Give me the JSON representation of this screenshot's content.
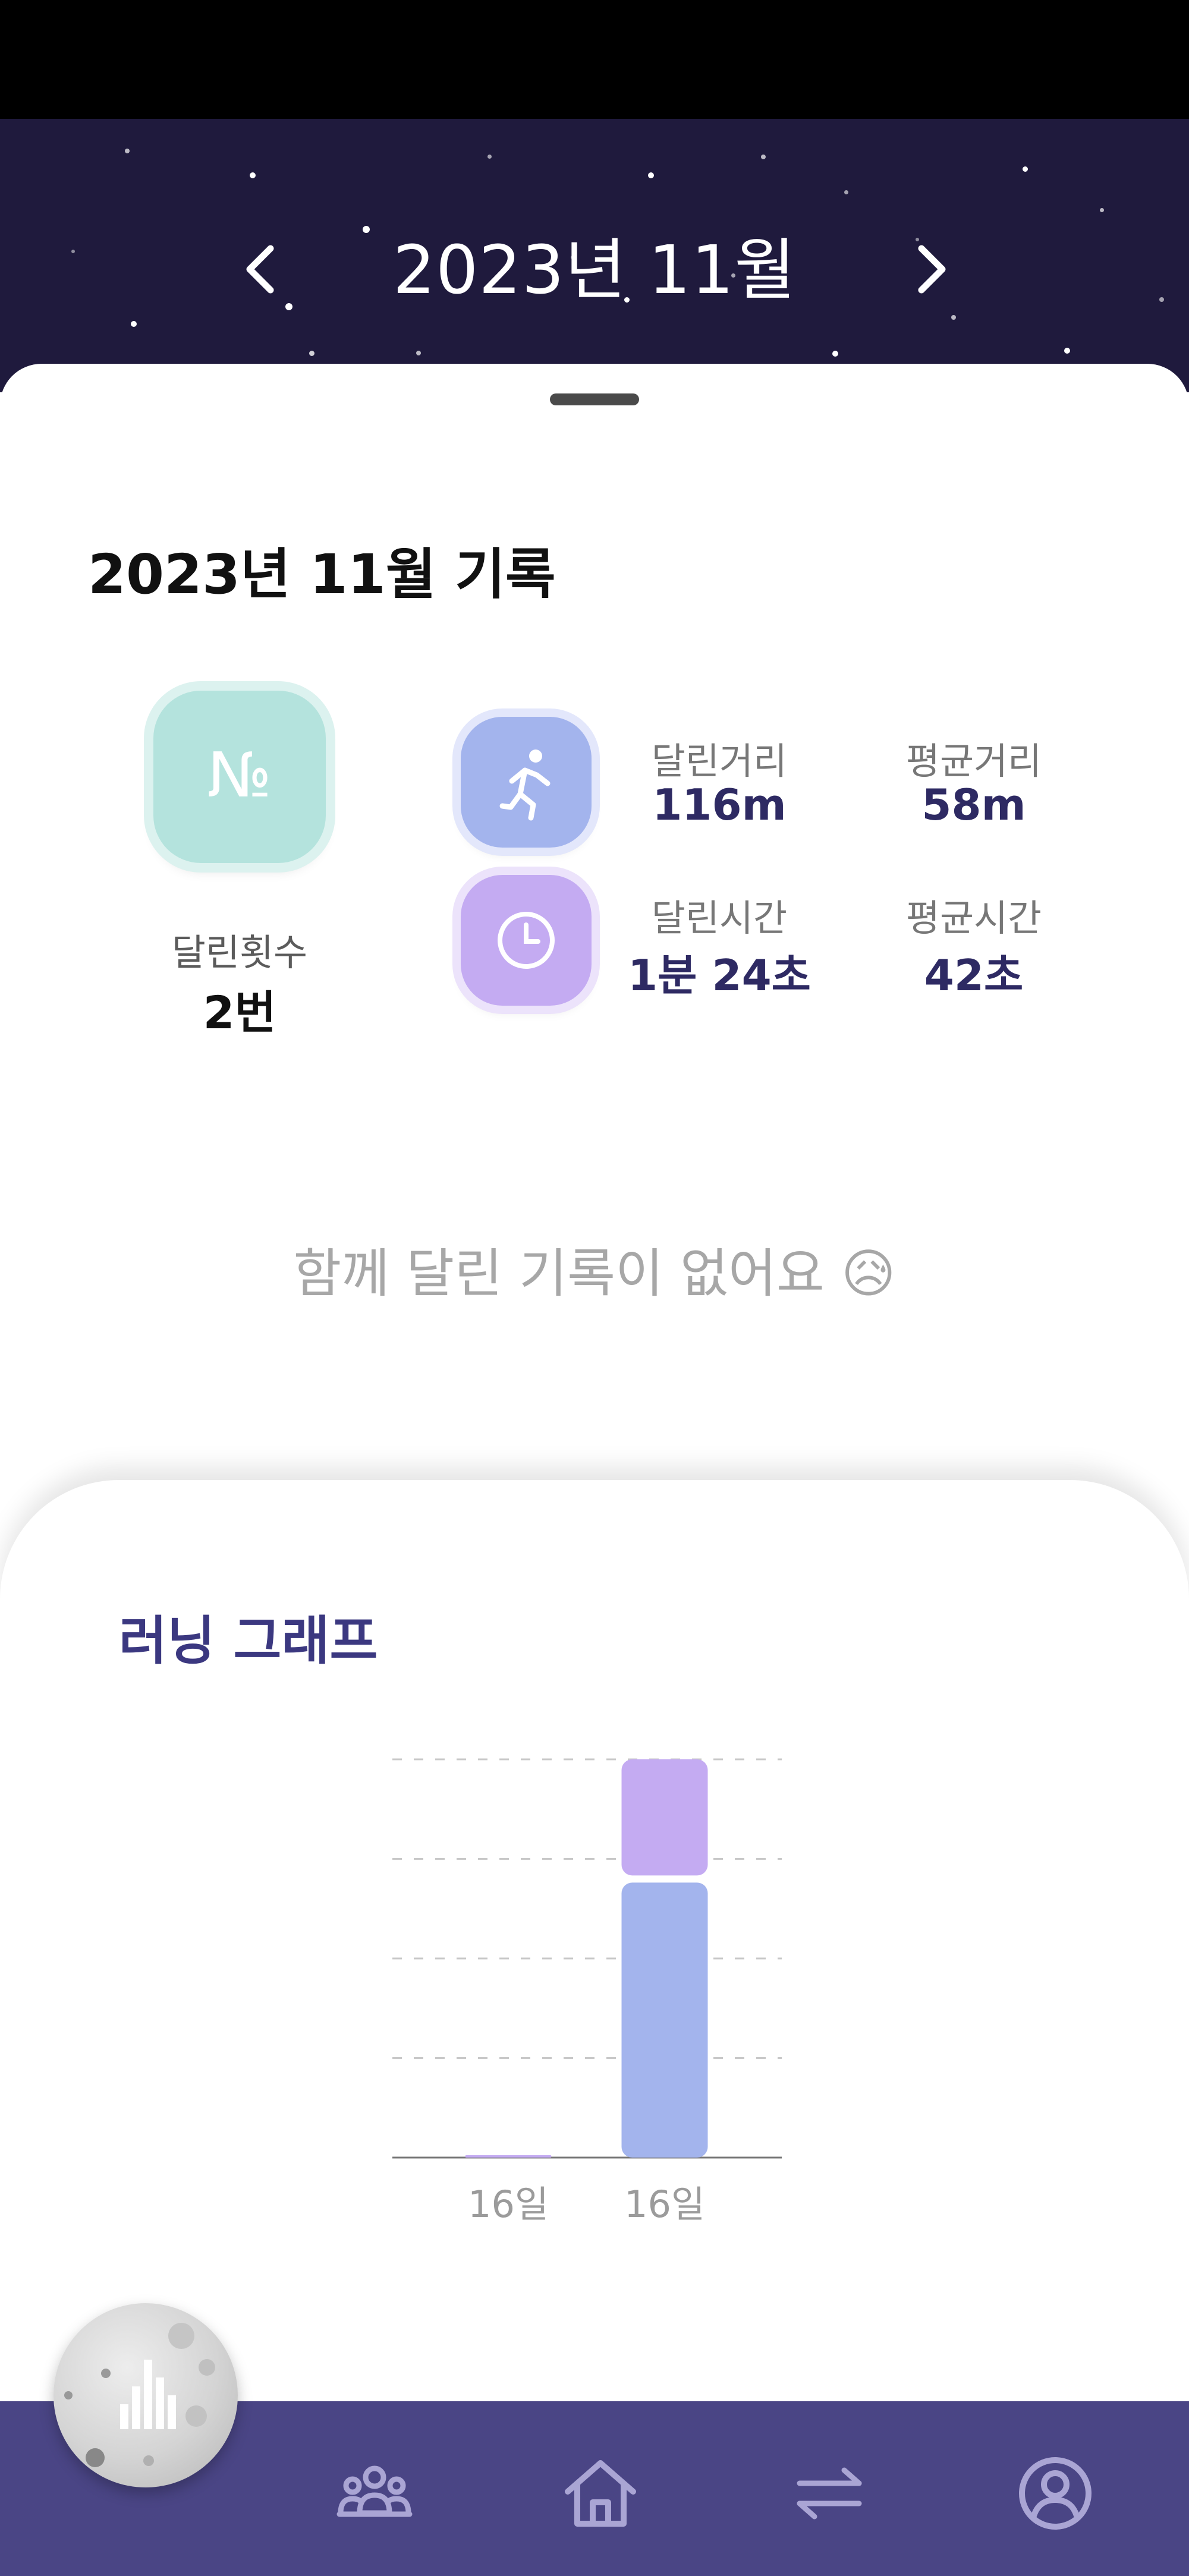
{
  "header": {
    "month_title": "2023년 11월",
    "prev_icon": "chevron-left-icon",
    "next_icon": "chevron-right-icon"
  },
  "record": {
    "title": "2023년 11월 기록",
    "count": {
      "icon": "number-sign-icon",
      "label": "달린횟수",
      "value": "2번"
    },
    "distance": {
      "icon": "runner-icon",
      "label": "달린거리",
      "value": "116m",
      "avg_label": "평균거리",
      "avg_value": "58m"
    },
    "time": {
      "icon": "clock-icon",
      "label": "달린시간",
      "value": "1분 24초",
      "avg_label": "평균시간",
      "avg_value": "42초"
    }
  },
  "together": {
    "empty_message": "함께 달린 기록이 없어요 😥"
  },
  "graph": {
    "title": "러닝 그래프"
  },
  "chart_data": {
    "type": "bar",
    "stacked": true,
    "categories": [
      "16일",
      "16일"
    ],
    "series": [
      {
        "values": [
          0,
          58
        ],
        "color": "#a3b4ed"
      },
      {
        "values": [
          0.5,
          26
        ],
        "color": "#c4abf2"
      }
    ],
    "ylim": [
      0,
      84
    ],
    "grid": true
  },
  "bottom_nav": {
    "items": [
      {
        "icon": "group-icon"
      },
      {
        "icon": "home-icon"
      },
      {
        "icon": "swap-arrows-icon"
      },
      {
        "icon": "profile-icon"
      }
    ],
    "fab_icon": "moon-bar-chart-icon"
  },
  "colors": {
    "header_bg": "#1f1a3d",
    "nav_bg": "#4a4585",
    "accent_text": "#2e2a63",
    "count_tile": "#b4e3dd",
    "distance_tile": "#a3b4ed",
    "time_tile": "#c4abf2"
  }
}
